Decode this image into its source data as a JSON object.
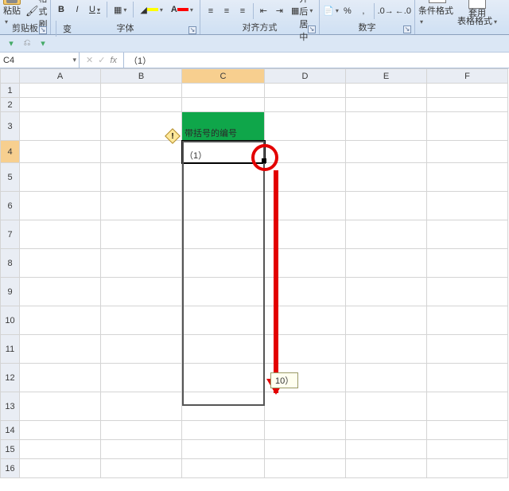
{
  "ribbon": {
    "clipboard": {
      "paste": "粘贴",
      "format_painter": "格式刷",
      "label": "剪贴板"
    },
    "font": {
      "bold": "B",
      "italic": "I",
      "underline": "U",
      "wen": "变",
      "label": "字体",
      "fill_color": "#ffff00",
      "font_color": "#ff0000"
    },
    "alignment": {
      "merge": "合并后居中",
      "label": "对齐方式"
    },
    "number": {
      "percent": "%",
      "comma": ",",
      "label": "数字"
    },
    "styles": {
      "cond": "条件格式",
      "table": "套用\n表格格式"
    }
  },
  "namebox": "C4",
  "fx_label": "fx",
  "formula": "（1）",
  "columns": [
    "A",
    "B",
    "C",
    "D",
    "E",
    "F"
  ],
  "rows": [
    "1",
    "2",
    "3",
    "4",
    "5",
    "6",
    "7",
    "8",
    "9",
    "10",
    "11",
    "12",
    "13",
    "14",
    "15",
    "16"
  ],
  "cells": {
    "C3": "带括号的编号",
    "C4": "（1）"
  },
  "drag_tooltip": "10）",
  "chart_data": {
    "type": "table",
    "title": "带括号的编号",
    "columns": [
      "C"
    ],
    "rows": [
      {
        "row": 4,
        "C": "（1）"
      }
    ],
    "note": "fill-handle drag from C4 down to C13 producing （1）…（10）"
  }
}
